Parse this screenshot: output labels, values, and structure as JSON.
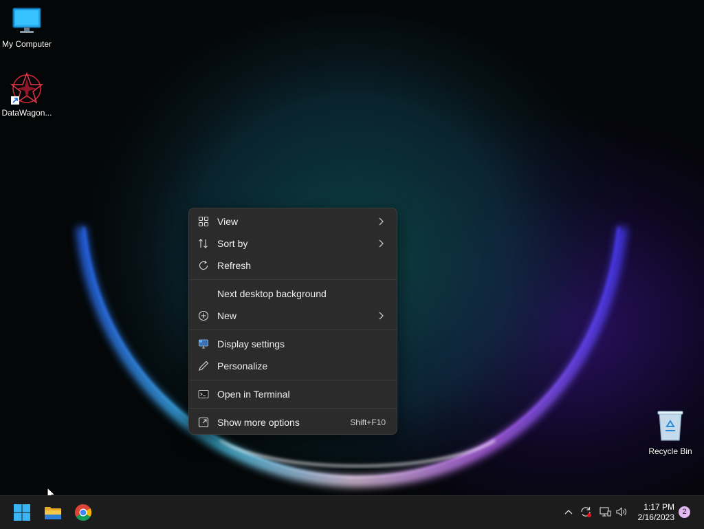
{
  "desktop": {
    "icons": [
      {
        "label": "My Computer",
        "icon": "monitor-icon"
      },
      {
        "label": "DataWagon...",
        "icon": "datawagon-shortcut-icon"
      },
      {
        "label": "Recycle Bin",
        "icon": "recycle-bin-icon"
      }
    ]
  },
  "context_menu": {
    "items": [
      {
        "label": "View",
        "icon": "grid-icon",
        "submenu": true
      },
      {
        "label": "Sort by",
        "icon": "sort-icon",
        "submenu": true
      },
      {
        "label": "Refresh",
        "icon": "refresh-icon"
      },
      {
        "label": "Next desktop background",
        "icon": ""
      },
      {
        "label": "New",
        "icon": "plus-circle-icon",
        "submenu": true
      },
      {
        "label": "Display settings",
        "icon": "display-icon"
      },
      {
        "label": "Personalize",
        "icon": "pen-icon"
      },
      {
        "label": "Open in Terminal",
        "icon": "terminal-icon"
      },
      {
        "label": "Show more options",
        "icon": "expand-icon",
        "shortcut": "Shift+F10"
      }
    ]
  },
  "taskbar": {
    "apps": [
      "start-icon",
      "file-explorer-icon",
      "chrome-icon"
    ],
    "tray_icons": [
      "chevron-up-icon",
      "sync-icon",
      "network-icon",
      "volume-icon"
    ],
    "time": "1:17 PM",
    "date": "2/16/2023",
    "notification_count": "2"
  },
  "colors": {
    "menu_bg": "#2b2b2b",
    "taskbar_bg": "#1c1c1c",
    "notif_badge": "#e3b8f0"
  }
}
